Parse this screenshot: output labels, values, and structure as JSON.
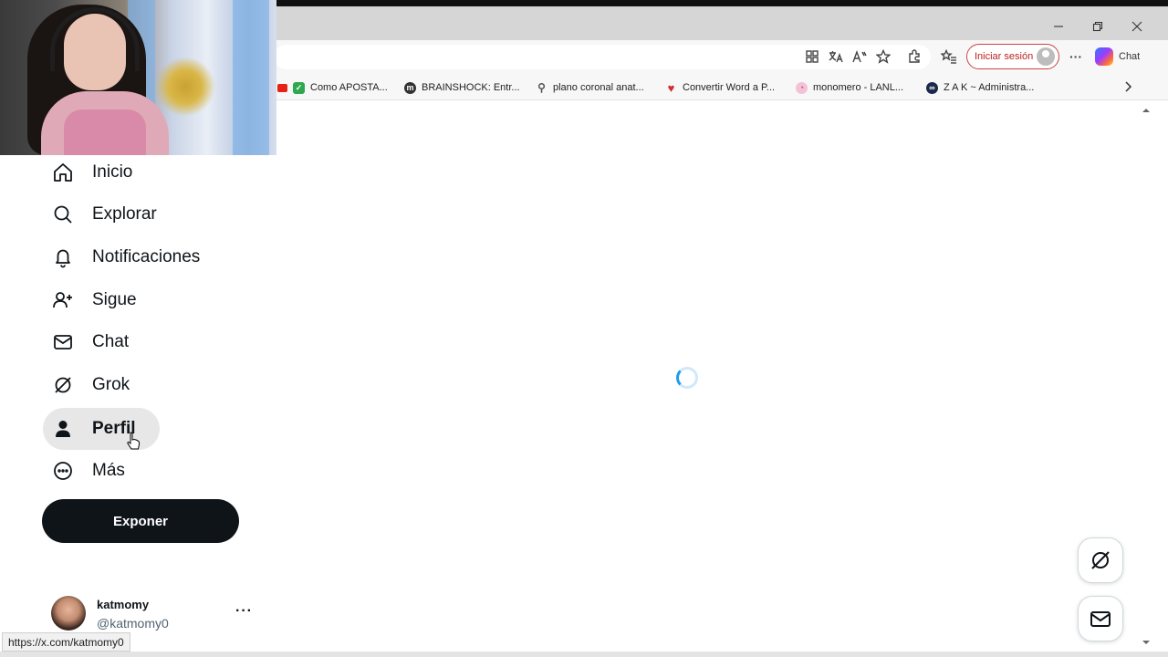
{
  "browser": {
    "signin_label": "Iniciar sesión",
    "copilot_label": "Chat",
    "bookmarks": [
      {
        "label": "Como APOSTA...",
        "color": "#2fa84f"
      },
      {
        "label": "BRAINSHOCK: Entr...",
        "color": "#333333"
      },
      {
        "label": "plano coronal anat...",
        "color": "#555555"
      },
      {
        "label": "Convertir Word a P...",
        "color": "#d22c2c"
      },
      {
        "label": "monomero - LANL...",
        "color": "#d23c7a"
      },
      {
        "label": "Z A K ~ Administra...",
        "color": "#1b2a4a"
      }
    ],
    "status_url": "https://x.com/katmomy0"
  },
  "nav": {
    "items": [
      {
        "label": "Inicio",
        "icon": "home-icon"
      },
      {
        "label": "Explorar",
        "icon": "search-icon"
      },
      {
        "label": "Notificaciones",
        "icon": "bell-icon"
      },
      {
        "label": "Sigue",
        "icon": "follow-icon"
      },
      {
        "label": "Chat",
        "icon": "mail-icon"
      },
      {
        "label": "Grok",
        "icon": "grok-icon"
      },
      {
        "label": "Perfil",
        "icon": "person-icon",
        "active": true
      },
      {
        "label": "Más",
        "icon": "more-circle-icon"
      }
    ],
    "post_label": "Exponer"
  },
  "account": {
    "name": "katmomy",
    "handle": "@katmomy0",
    "more": "···"
  },
  "colors": {
    "text": "#0f1419",
    "accent": "#1d9bf0",
    "post_button": "#0f1419",
    "active_bg": "#e7e7e7"
  }
}
